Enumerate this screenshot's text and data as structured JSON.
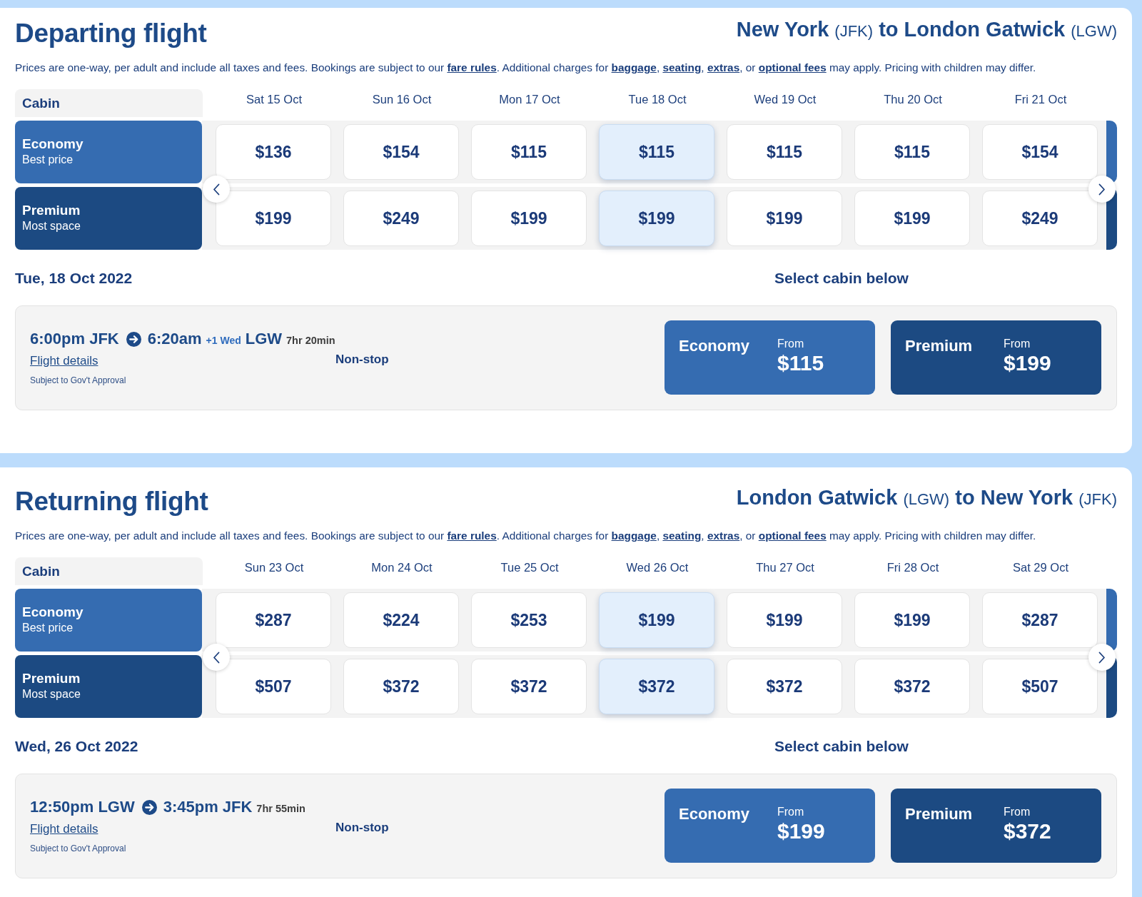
{
  "sections": [
    {
      "title": "Departing flight",
      "route": {
        "from_city": "New York",
        "from_code": "(JFK)",
        "connector": "to",
        "to_city": "London Gatwick",
        "to_code": "(LGW)"
      },
      "disclaimer": [
        {
          "kind": "text",
          "text": "Prices are one-way, per adult and include all taxes and fees. Bookings are subject to our "
        },
        {
          "kind": "link",
          "text": "fare rules"
        },
        {
          "kind": "text",
          "text": ". Additional charges for "
        },
        {
          "kind": "link",
          "text": "baggage"
        },
        {
          "kind": "text",
          "text": ", "
        },
        {
          "kind": "link",
          "text": "seating"
        },
        {
          "kind": "text",
          "text": ", "
        },
        {
          "kind": "link",
          "text": "extras"
        },
        {
          "kind": "text",
          "text": ", or "
        },
        {
          "kind": "link",
          "text": "optional fees"
        },
        {
          "kind": "text",
          "text": " may apply. Pricing with children may differ."
        }
      ],
      "cabin_header": "Cabin",
      "dates": [
        {
          "label": "Sat 15 Oct"
        },
        {
          "label": "Sun 16 Oct"
        },
        {
          "label": "Mon 17 Oct"
        },
        {
          "label": "Tue 18 Oct"
        },
        {
          "label": "Wed 19 Oct"
        },
        {
          "label": "Thu 20 Oct"
        },
        {
          "label": "Fri 21 Oct"
        }
      ],
      "cabins": [
        {
          "kind": "economy",
          "name": "Economy",
          "subtitle": "Best price",
          "fares": [
            {
              "price": "$136",
              "selected": false
            },
            {
              "price": "$154",
              "selected": false
            },
            {
              "price": "$115",
              "selected": false
            },
            {
              "price": "$115",
              "selected": true
            },
            {
              "price": "$115",
              "selected": false
            },
            {
              "price": "$115",
              "selected": false
            },
            {
              "price": "$154",
              "selected": false
            }
          ]
        },
        {
          "kind": "premium",
          "name": "Premium",
          "subtitle": "Most space",
          "fares": [
            {
              "price": "$199",
              "selected": false
            },
            {
              "price": "$249",
              "selected": false
            },
            {
              "price": "$199",
              "selected": false
            },
            {
              "price": "$199",
              "selected": true
            },
            {
              "price": "$199",
              "selected": false
            },
            {
              "price": "$199",
              "selected": false
            },
            {
              "price": "$249",
              "selected": false
            }
          ]
        }
      ],
      "selected_date": "Tue, 18 Oct 2022",
      "cabin_prompt": "Select cabin below",
      "flight": {
        "departure": "6:00pm JFK",
        "arrival_time": "6:20am",
        "day_offset": "+1 Wed",
        "arrival_airport": "LGW",
        "duration": "7hr 20min",
        "details_link": "Flight details",
        "stops": "Non-stop",
        "note": "Subject to Gov't Approval",
        "options": [
          {
            "kind": "economy",
            "name": "Economy",
            "from_label": "From",
            "price": "$115"
          },
          {
            "kind": "premium",
            "name": "Premium",
            "from_label": "From",
            "price": "$199"
          }
        ]
      }
    },
    {
      "title": "Returning flight",
      "route": {
        "from_city": "London Gatwick",
        "from_code": "(LGW)",
        "connector": "to",
        "to_city": "New York",
        "to_code": "(JFK)"
      },
      "disclaimer": [
        {
          "kind": "text",
          "text": "Prices are one-way, per adult and include all taxes and fees. Bookings are subject to our "
        },
        {
          "kind": "link",
          "text": "fare rules"
        },
        {
          "kind": "text",
          "text": ". Additional charges for "
        },
        {
          "kind": "link",
          "text": "baggage"
        },
        {
          "kind": "text",
          "text": ", "
        },
        {
          "kind": "link",
          "text": "seating"
        },
        {
          "kind": "text",
          "text": ", "
        },
        {
          "kind": "link",
          "text": "extras"
        },
        {
          "kind": "text",
          "text": ", or "
        },
        {
          "kind": "link",
          "text": "optional fees"
        },
        {
          "kind": "text",
          "text": " may apply. Pricing with children may differ."
        }
      ],
      "cabin_header": "Cabin",
      "dates": [
        {
          "label": "Sun 23 Oct"
        },
        {
          "label": "Mon 24 Oct"
        },
        {
          "label": "Tue 25 Oct"
        },
        {
          "label": "Wed 26 Oct"
        },
        {
          "label": "Thu 27 Oct"
        },
        {
          "label": "Fri 28 Oct"
        },
        {
          "label": "Sat 29 Oct"
        }
      ],
      "cabins": [
        {
          "kind": "economy",
          "name": "Economy",
          "subtitle": "Best price",
          "fares": [
            {
              "price": "$287",
              "selected": false
            },
            {
              "price": "$224",
              "selected": false
            },
            {
              "price": "$253",
              "selected": false
            },
            {
              "price": "$199",
              "selected": true
            },
            {
              "price": "$199",
              "selected": false
            },
            {
              "price": "$199",
              "selected": false
            },
            {
              "price": "$287",
              "selected": false
            }
          ]
        },
        {
          "kind": "premium",
          "name": "Premium",
          "subtitle": "Most space",
          "fares": [
            {
              "price": "$507",
              "selected": false
            },
            {
              "price": "$372",
              "selected": false
            },
            {
              "price": "$372",
              "selected": false
            },
            {
              "price": "$372",
              "selected": true
            },
            {
              "price": "$372",
              "selected": false
            },
            {
              "price": "$372",
              "selected": false
            },
            {
              "price": "$507",
              "selected": false
            }
          ]
        }
      ],
      "selected_date": "Wed, 26 Oct 2022",
      "cabin_prompt": "Select cabin below",
      "flight": {
        "departure": "12:50pm LGW",
        "arrival_time": "3:45pm",
        "arrival_airport": "JFK",
        "duration": "7hr 55min",
        "details_link": "Flight details",
        "stops": "Non-stop",
        "note": "Subject to Gov't Approval",
        "options": [
          {
            "kind": "economy",
            "name": "Economy",
            "from_label": "From",
            "price": "$199"
          },
          {
            "kind": "premium",
            "name": "Premium",
            "from_label": "From",
            "price": "$372"
          }
        ]
      }
    }
  ]
}
